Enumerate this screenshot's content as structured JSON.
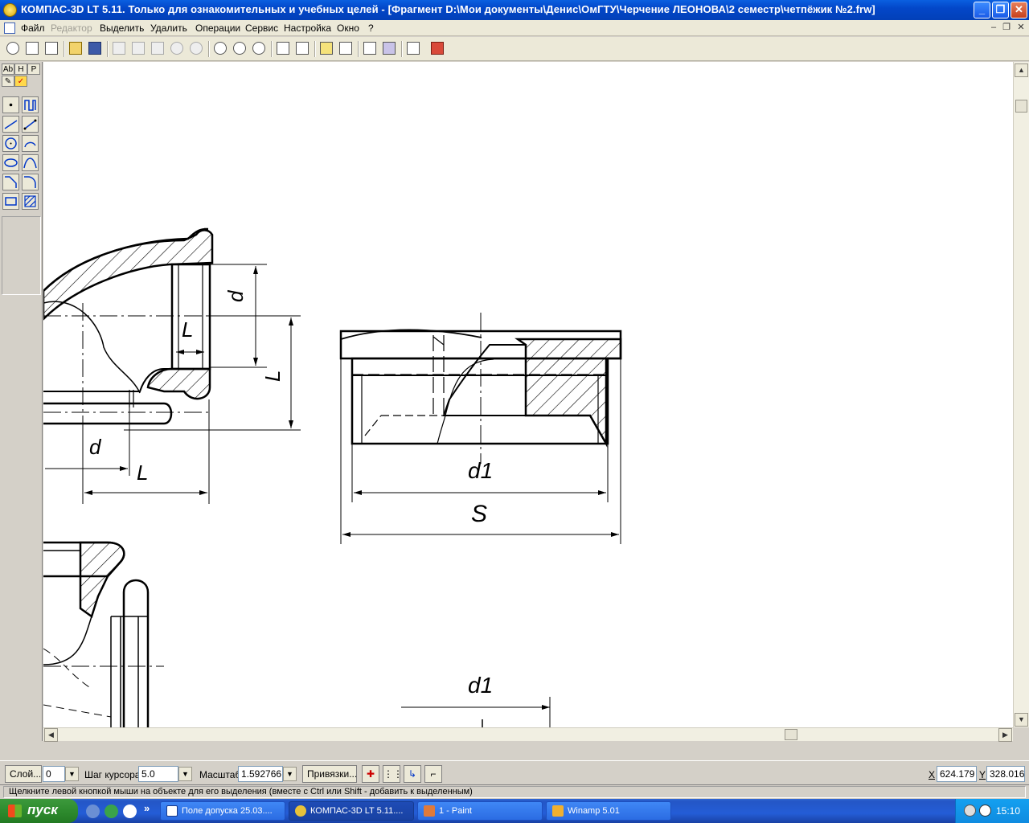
{
  "window": {
    "title": "КОМПАС-3D LT 5.11. Только для ознакомительных и учебных целей - [Фрагмент D:\\Мои документы\\Денис\\ОмГТУ\\Черчение ЛЕОНОВА\\2 семестр\\четпёжик №2.frw]",
    "minimize": "_",
    "maximize": "❐",
    "close": "✕"
  },
  "menu": {
    "items": [
      {
        "label": "Файл",
        "disabled": false
      },
      {
        "label": "Редактор",
        "disabled": true
      },
      {
        "label": "Выделить",
        "disabled": false
      },
      {
        "label": "Удалить",
        "disabled": false
      },
      {
        "label": "Операции",
        "disabled": false
      },
      {
        "label": "Сервис",
        "disabled": false
      },
      {
        "label": "Настройка",
        "disabled": false
      },
      {
        "label": "Окно",
        "disabled": false
      },
      {
        "label": "?",
        "disabled": false
      }
    ],
    "mdi_min": "–",
    "mdi_restore": "❐",
    "mdi_close": "✕"
  },
  "left_tabs": [
    "Аb",
    "H",
    "P"
  ],
  "drawing": {
    "labels": {
      "d_top": "d",
      "l_inner": "L",
      "l_side": "L",
      "d_bottom": "d",
      "l_bottom": "L",
      "d1_center": "d1",
      "s_center": "S",
      "d1_bottom": "d1"
    }
  },
  "propbar": {
    "layer_button": "Слой...",
    "layer_value": "0",
    "cursor_step_label": "Шаг курсора",
    "cursor_step_value": "5.0",
    "scale_label": "Масштаб",
    "scale_value": "1.592766",
    "snap_button": "Привязки...",
    "x_label": "X",
    "x_value": "624.179",
    "y_label": "Y",
    "y_value": "328.016"
  },
  "hint": "Щелкните левой кнопкой мыши на объекте для его выделения (вместе с Ctrl или Shift - добавить к выделенным)",
  "taskbar": {
    "start": "пуск",
    "tasks": [
      {
        "label": "Поле допуска 25.03....",
        "active": false
      },
      {
        "label": "КОМПАС-3D LT 5.11....",
        "active": true
      },
      {
        "label": "1 - Paint",
        "active": false
      },
      {
        "label": "Winamp 5.01",
        "active": false
      }
    ],
    "more": "»",
    "clock": "15:10"
  },
  "colors": {
    "titlebar": "#0347c9",
    "canvas": "#ffffff",
    "taskbar": "#245dd7",
    "start": "#2e8b2e"
  }
}
